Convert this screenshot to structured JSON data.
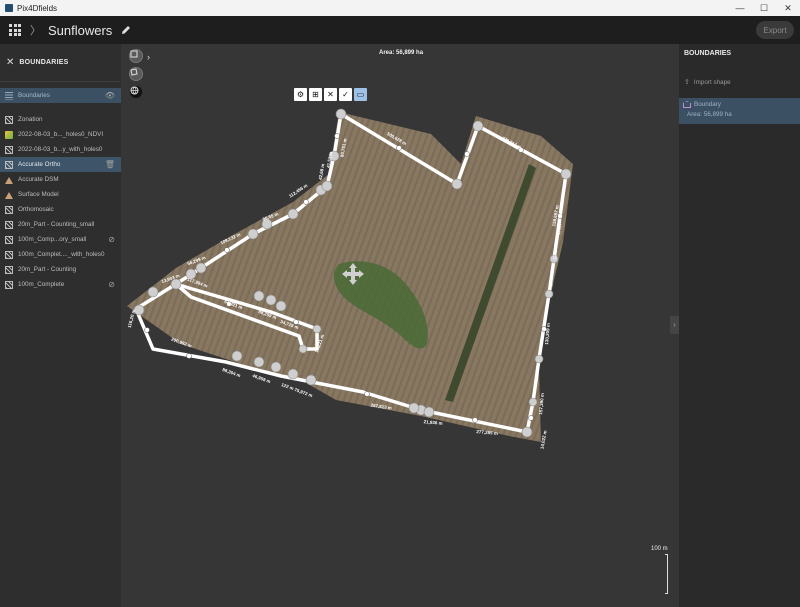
{
  "window": {
    "title": "Pix4Dfields",
    "controls": [
      "—",
      "☐",
      "✕"
    ]
  },
  "header": {
    "project": "Sunflowers",
    "export_label": "Export"
  },
  "left_panel": {
    "title": "BOUNDARIES",
    "boundaries_label": "Boundaries",
    "layers": [
      {
        "label": "Zonation",
        "icon": "checker-icon"
      },
      {
        "label": "2022-08-03_b..._holes0_NDVI",
        "icon": "ndvi-icon"
      },
      {
        "label": "2022-08-03_b...y_with_holes0",
        "icon": "checker-icon"
      },
      {
        "label": "Accurate Ortho",
        "icon": "checker-icon",
        "selected": true
      },
      {
        "label": "Accurate DSM",
        "icon": "dsm-icon"
      },
      {
        "label": "Surface Model",
        "icon": "dsm-icon"
      },
      {
        "label": "Orthomosaic",
        "icon": "checker-icon"
      },
      {
        "label": "20m_Part - Counting_small",
        "icon": "checker-icon"
      },
      {
        "label": "100m_Comp...ory_small",
        "icon": "checker-icon",
        "hidden": true
      },
      {
        "label": "100m_Complet...._with_holes0",
        "icon": "checker-icon"
      },
      {
        "label": "20m_Part - Counting",
        "icon": "checker-icon"
      },
      {
        "label": "100m_Complete",
        "icon": "checker-icon",
        "hidden": true
      }
    ]
  },
  "map": {
    "area_label": "Area: 56,899 ha",
    "scale_label": "100 m",
    "edge_labels": [
      "500,628 m",
      "278,817 m",
      "158,697 m",
      "112,456 m",
      "96,65 m",
      "109,132 m",
      "56,299 m",
      "13,903 m",
      "117,984 m",
      "64,421 m",
      "88,259 m",
      "34,729 m",
      "14,221 m",
      "290,992 m",
      "88,304 m",
      "46,958 m",
      "122 m",
      "75,972 m",
      "287,813 m",
      "21,936 m",
      "277,285 m",
      "14,022 m",
      "157,390 m",
      "130,209 m",
      "114,339 m",
      "112,697 m",
      "172,607 m",
      "80,751 m",
      "41,51 m",
      "42,68 m",
      "116,20 m"
    ]
  },
  "right_panel": {
    "title": "BOUNDARIES",
    "import_label": "Import shape",
    "boundary_name": "Boundary",
    "boundary_area": "Area: 56,899 ha"
  }
}
